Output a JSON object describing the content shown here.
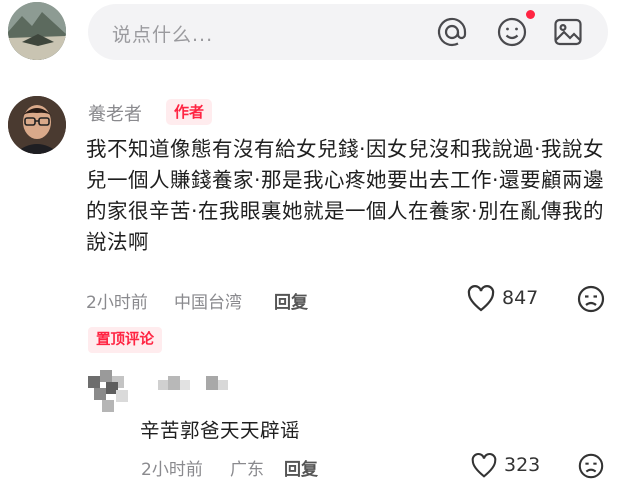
{
  "input": {
    "placeholder": "说点什么..."
  },
  "icons": {
    "at": "at-icon",
    "emoji": "emoji-icon",
    "image": "image-icon",
    "like": "heart-icon",
    "dislike": "dislike-face-icon"
  },
  "colors": {
    "accent": "#ff2442",
    "tag_bg": "#ffecee",
    "input_bg": "#f3f3f5",
    "meta": "#8a8a8e"
  },
  "comment": {
    "username": "養老者",
    "author_tag": "作者",
    "text": "我不知道像態有沒有給女兒錢·因女兒沒和我說過·我說女兒一個人賺錢養家·那是我心疼她要出去工作·還要顧兩邊的家很辛苦·在我眼裏她就是一個人在養家·別在亂傳我的說法啊",
    "time": "2小时前",
    "location": "中国台湾",
    "reply_label": "回复",
    "likes": "847"
  },
  "pinned_label": "置顶评论",
  "reply": {
    "text": "辛苦郭爸天天辟谣",
    "time": "2小时前",
    "location": "广东",
    "reply_label": "回复",
    "likes": "323"
  }
}
